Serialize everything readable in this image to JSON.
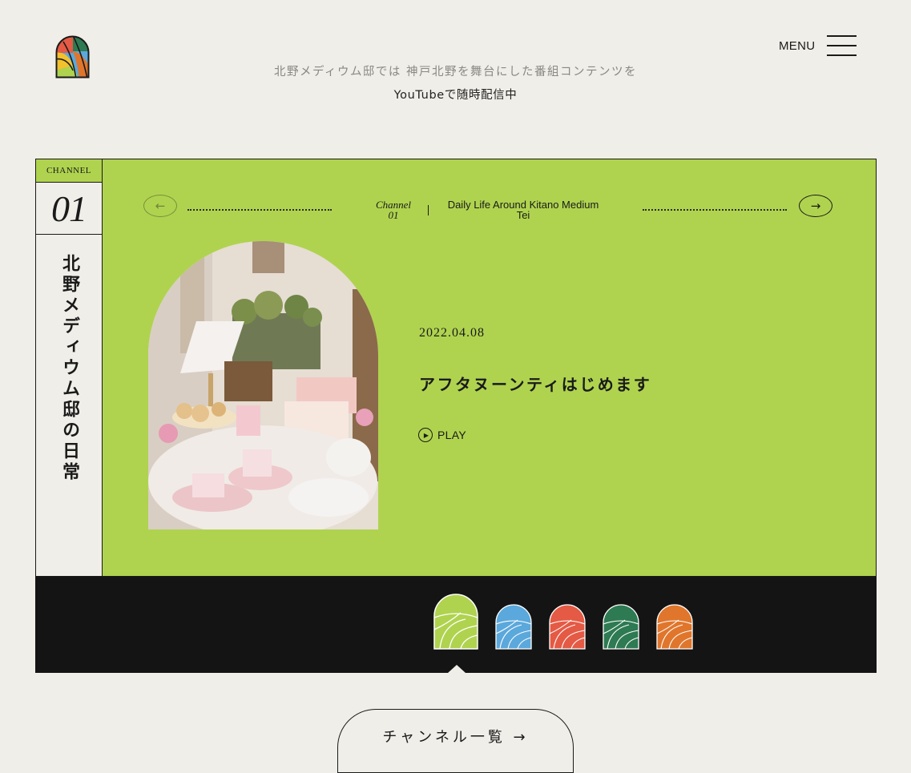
{
  "header": {
    "logo_icon": "stained-glass-arch-logo",
    "menu_label": "MENU",
    "menu_icon": "hamburger-icon"
  },
  "intro": {
    "line1": "北野メディウム邸では 神戸北野を舞台にした番組コンテンツを",
    "line2": "YouTubeで随時配信中"
  },
  "channel": {
    "tag": "CHANNEL",
    "number": "01",
    "title_jp": "北野メディウム邸の日常",
    "label_line1": "Channel",
    "label_line2": "01",
    "name_line1": "Daily Life Around Kitano Medium",
    "name_line2": "Tei",
    "accent_color": "#afd34f"
  },
  "episode": {
    "date": "2022.04.08",
    "title": "アフタヌーンティはじめます",
    "play_label": "PLAY"
  },
  "channel_icons": [
    {
      "name": "channel-01",
      "color": "#afd34f",
      "active": true
    },
    {
      "name": "channel-02",
      "color": "#5ba8dc",
      "active": false
    },
    {
      "name": "channel-03",
      "color": "#e45a45",
      "active": false
    },
    {
      "name": "channel-04",
      "color": "#2e7a52",
      "active": false
    },
    {
      "name": "channel-05",
      "color": "#e0762c",
      "active": false
    }
  ],
  "footer": {
    "list_button_label": "チャンネル一覧 →"
  }
}
